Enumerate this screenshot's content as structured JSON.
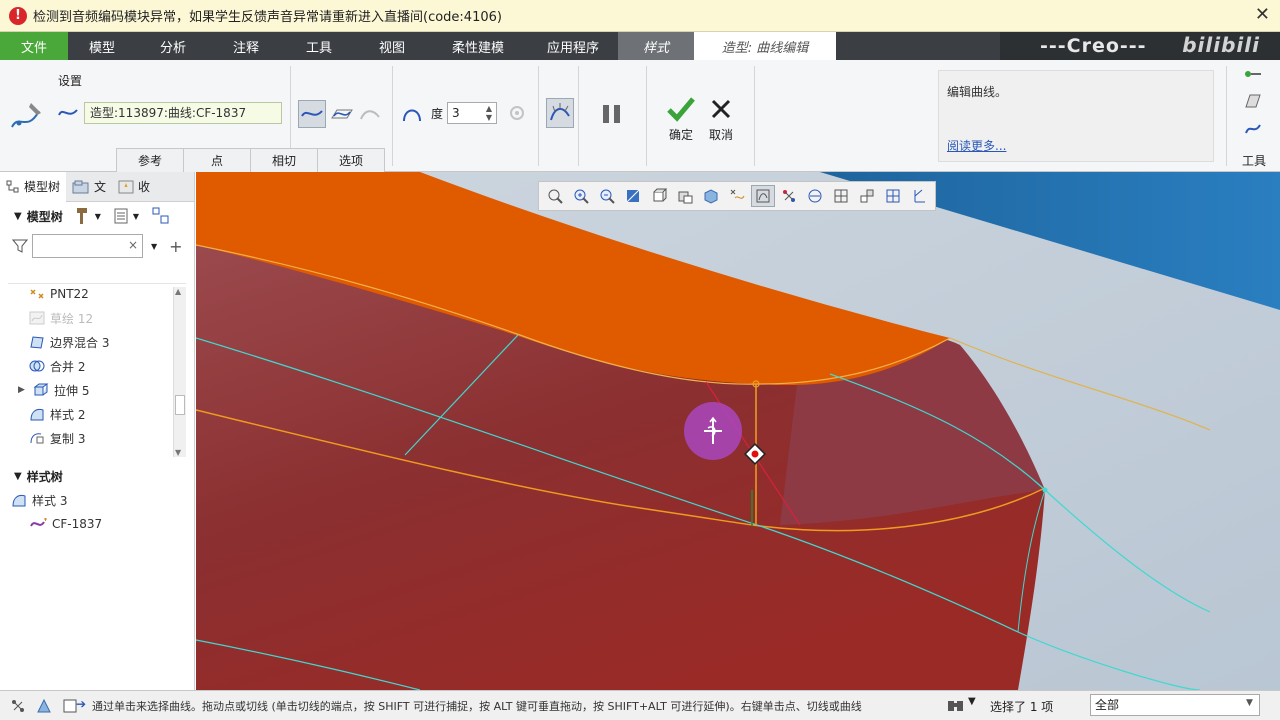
{
  "alert": {
    "message": "检测到音频编码模块异常，如果学生反馈声音异常请重新进入直播间(code:4106)",
    "close": "✕"
  },
  "menu": {
    "tabs": [
      "文件",
      "模型",
      "分析",
      "注释",
      "工具",
      "视图",
      "柔性建模",
      "应用程序"
    ],
    "style_tab": "样式",
    "active_tab": "造型: 曲线编辑",
    "brand": "---Creo---",
    "watermark": "bilibili"
  },
  "ribbon": {
    "settings_label": "设置",
    "reference": "造型:113897:曲线:CF-1837",
    "degree_label": "度",
    "degree_value": "3",
    "subtabs": [
      "参考",
      "点",
      "相切",
      "选项"
    ],
    "ok_label": "确定",
    "cancel_label": "取消",
    "help_text": "编辑曲线。",
    "help_link": "阅读更多...",
    "tools_label": "工具"
  },
  "panel": {
    "tabs": [
      "模型树",
      "文",
      "收"
    ],
    "tree_header": "模型树",
    "items": [
      {
        "label": "PNT22",
        "dim": false,
        "expand": ""
      },
      {
        "label": "草绘 12",
        "dim": true,
        "expand": ""
      },
      {
        "label": "边界混合 3",
        "dim": false,
        "expand": ""
      },
      {
        "label": "合并 2",
        "dim": false,
        "expand": ""
      },
      {
        "label": "拉伸 5",
        "dim": false,
        "expand": "▶"
      },
      {
        "label": "样式 2",
        "dim": false,
        "expand": ""
      },
      {
        "label": "复制 3",
        "dim": false,
        "expand": ""
      }
    ],
    "style_tree_header": "样式树",
    "style_root": "样式 3",
    "style_child": "CF-1837"
  },
  "status": {
    "message": "通过单击来选择曲线。拖动点或切线 (单击切线的端点，按 SHIFT 可进行捕捉，按 ALT 键可垂直拖动，按 SHIFT+ALT 可进行延伸)。右键单击点、切线或曲线",
    "selected": "选择了 1 项",
    "filter": "全部"
  },
  "colors": {
    "file_tab": "#4aa73a",
    "menubar": "#3b3f43",
    "surface_red": "#8e2d2d",
    "surface_orange": "#e05a00",
    "sky_blue": "#1f6fa8",
    "curve_orange": "#f0a020",
    "curve_cyan": "#40d8d0"
  }
}
